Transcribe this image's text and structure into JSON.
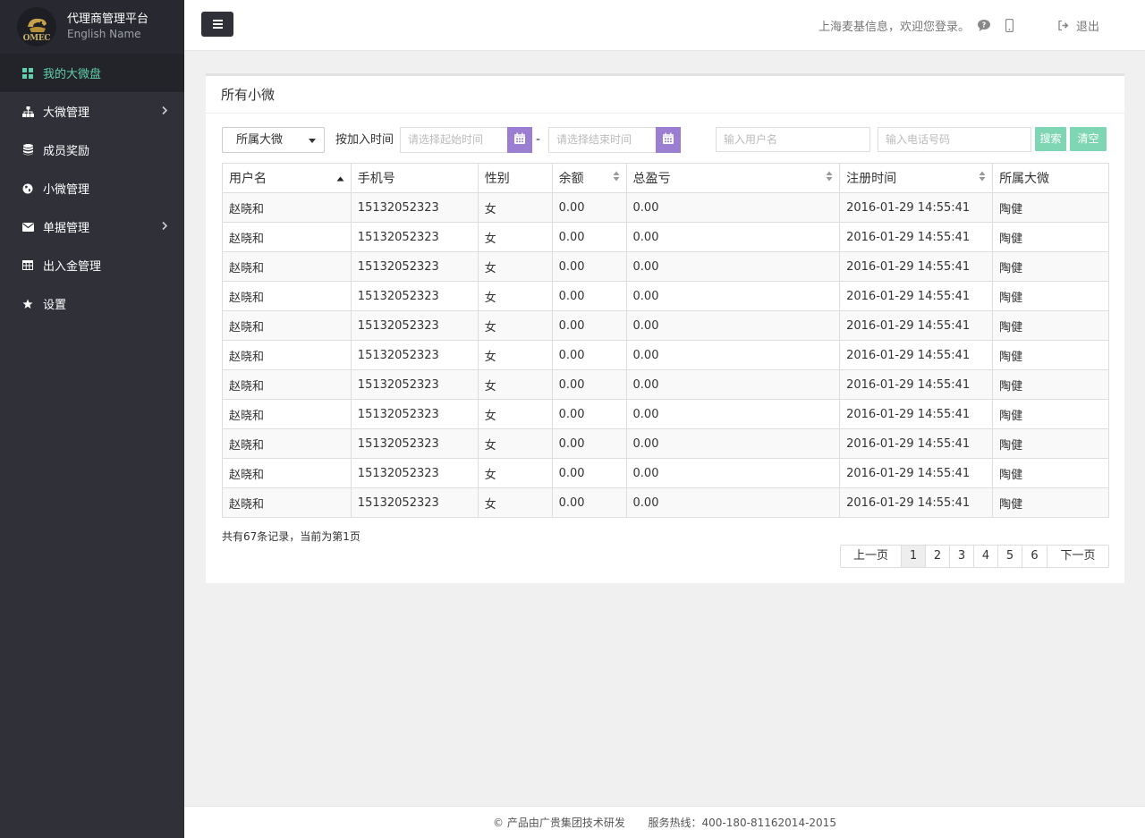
{
  "brand": {
    "title": "代理商管理平台",
    "subtitle": "English Name",
    "logo_text": "OMEC"
  },
  "sidebar": {
    "items": [
      {
        "label": "我的大微盘",
        "icon": "grid-icon",
        "active": true,
        "has_submenu": false
      },
      {
        "label": "大微管理",
        "icon": "sitemap-icon",
        "active": false,
        "has_submenu": true
      },
      {
        "label": "成员奖励",
        "icon": "database-icon",
        "active": false,
        "has_submenu": false
      },
      {
        "label": "小微管理",
        "icon": "globe-icon",
        "active": false,
        "has_submenu": false
      },
      {
        "label": "单据管理",
        "icon": "envelope-icon",
        "active": false,
        "has_submenu": true
      },
      {
        "label": "出入金管理",
        "icon": "table-icon",
        "active": false,
        "has_submenu": false
      },
      {
        "label": "设置",
        "icon": "star-icon",
        "active": false,
        "has_submenu": false
      }
    ]
  },
  "header": {
    "welcome": "上海麦基信息，欢迎您登录。",
    "logout_label": "退出"
  },
  "panel": {
    "title": "所有小微"
  },
  "filters": {
    "select_value": "所属大微",
    "time_label": "按加入时间",
    "start_placeholder": "请选择起始时间",
    "separator": "-",
    "end_placeholder": "请选择结束时间",
    "username_placeholder": "输入用户名",
    "phone_placeholder": "输入电话号码",
    "search_label": "搜索",
    "clear_label": "清空"
  },
  "table": {
    "headers": [
      "用户名",
      "手机号",
      "性别",
      "余额",
      "总盈亏",
      "注册时间",
      "所属大微"
    ],
    "rows": [
      [
        "赵晓和",
        "15132052323",
        "女",
        "0.00",
        "0.00",
        "2016-01-29 14:55:41",
        "陶健"
      ],
      [
        "赵晓和",
        "15132052323",
        "女",
        "0.00",
        "0.00",
        "2016-01-29 14:55:41",
        "陶健"
      ],
      [
        "赵晓和",
        "15132052323",
        "女",
        "0.00",
        "0.00",
        "2016-01-29 14:55:41",
        "陶健"
      ],
      [
        "赵晓和",
        "15132052323",
        "女",
        "0.00",
        "0.00",
        "2016-01-29 14:55:41",
        "陶健"
      ],
      [
        "赵晓和",
        "15132052323",
        "女",
        "0.00",
        "0.00",
        "2016-01-29 14:55:41",
        "陶健"
      ],
      [
        "赵晓和",
        "15132052323",
        "女",
        "0.00",
        "0.00",
        "2016-01-29 14:55:41",
        "陶健"
      ],
      [
        "赵晓和",
        "15132052323",
        "女",
        "0.00",
        "0.00",
        "2016-01-29 14:55:41",
        "陶健"
      ],
      [
        "赵晓和",
        "15132052323",
        "女",
        "0.00",
        "0.00",
        "2016-01-29 14:55:41",
        "陶健"
      ],
      [
        "赵晓和",
        "15132052323",
        "女",
        "0.00",
        "0.00",
        "2016-01-29 14:55:41",
        "陶健"
      ],
      [
        "赵晓和",
        "15132052323",
        "女",
        "0.00",
        "0.00",
        "2016-01-29 14:55:41",
        "陶健"
      ],
      [
        "赵晓和",
        "15132052323",
        "女",
        "0.00",
        "0.00",
        "2016-01-29 14:55:41",
        "陶健"
      ]
    ]
  },
  "record_info": "共有67条记录，当前为第1页",
  "pagination": {
    "prev_label": "上一页",
    "pages": [
      "1",
      "2",
      "3",
      "4",
      "5",
      "6"
    ],
    "current": "1",
    "next_label": "下一页"
  },
  "footer": {
    "copyright": "© 产品由广贵集团技术研发",
    "hotline": "服务热线：400-180-81162014-2015"
  },
  "colors": {
    "sidebar_bg": "#2f3038",
    "active_nav_text": "#5fd0a9",
    "calendar_button": "#9b7dd2",
    "action_button": "#7fd6b4"
  }
}
